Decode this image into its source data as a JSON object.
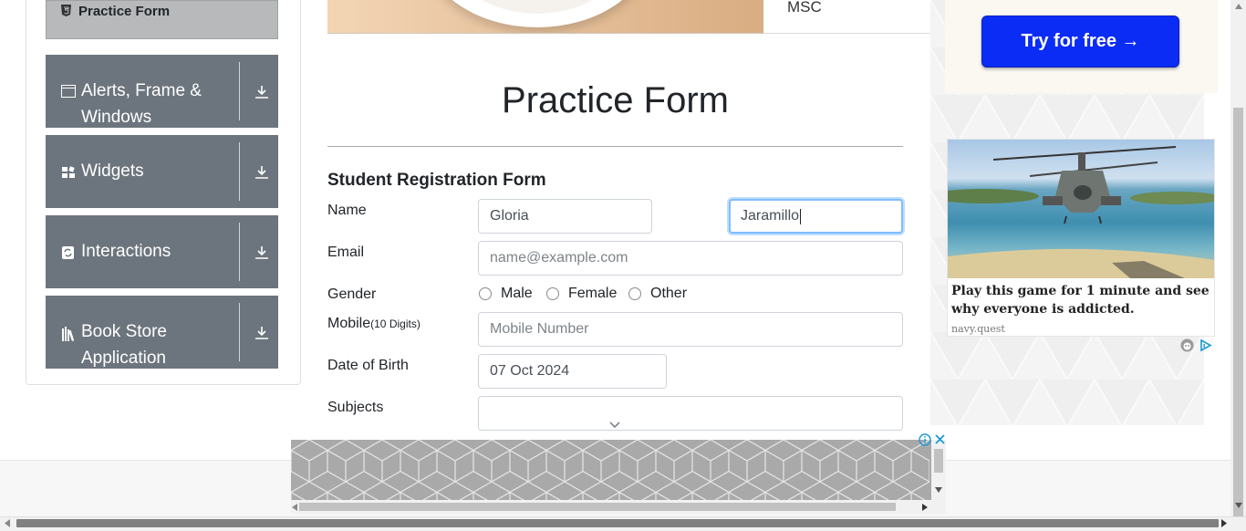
{
  "sidebar": {
    "active_item": "Practice Form",
    "groups": [
      {
        "label": "Alerts, Frame & Windows"
      },
      {
        "label": "Widgets"
      },
      {
        "label": "Interactions"
      },
      {
        "label": "Book Store Application"
      }
    ]
  },
  "banner": {
    "text": "MSC"
  },
  "page": {
    "title": "Practice Form"
  },
  "form": {
    "title": "Student Registration Form",
    "name_label": "Name",
    "first_name_value": "Gloria",
    "last_name_value": "Jaramillo",
    "email_label": "Email",
    "email_placeholder": "name@example.com",
    "gender_label": "Gender",
    "gender_options": [
      "Male",
      "Female",
      "Other"
    ],
    "mobile_label": "Mobile",
    "mobile_hint": "(10 Digits)",
    "mobile_placeholder": "Mobile Number",
    "dob_label": "Date of Birth",
    "dob_value": "07 Oct 2024",
    "subjects_label": "Subjects"
  },
  "ads": {
    "cta_label": "Try for free →",
    "card_headline": "Play this game for 1 minute and see why everyone is addicted.",
    "card_source": "navy.quest"
  },
  "colors": {
    "sidebar_group": "#6c757d",
    "cta": "#0b2cf5",
    "focus_border": "#80bdff"
  }
}
